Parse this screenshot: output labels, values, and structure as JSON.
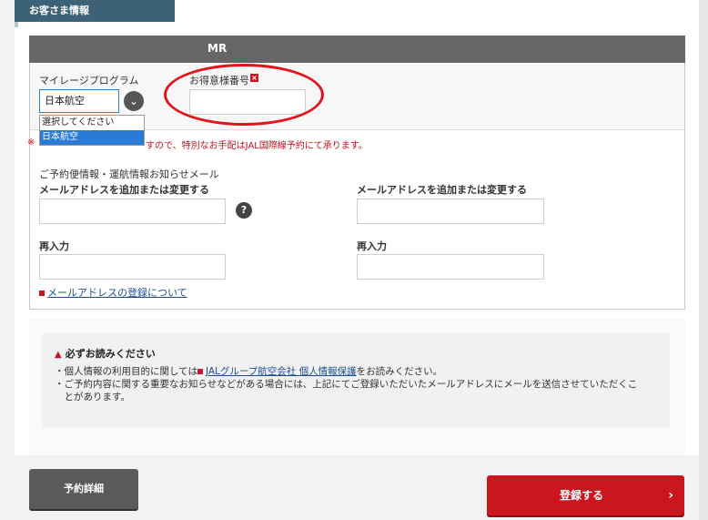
{
  "section": {
    "title": "お客さま情報"
  },
  "passenger": {
    "title_label": "MR"
  },
  "mileage": {
    "program_label": "マイレージプログラム",
    "selected_value": "日本航空",
    "options": [
      "選択してください",
      "日本航空"
    ],
    "member_number_label": "お得意様番号",
    "required_mark": "×",
    "member_number_value": "",
    "notice_visible_tail": "すので、特別なお手配はJAL国際線予約にて承ります。",
    "notice_prefix": "※"
  },
  "email": {
    "heading": "ご予約便情報・運航情報お知らせメール",
    "left_label": "メールアドレスを追加または変更する",
    "right_label": "メールアドレスを追加または変更する",
    "reenter_left": "再入力",
    "reenter_right": "再入力",
    "help_glyph": "?",
    "registration_link": "メールアドレスの登録について"
  },
  "notice": {
    "title": "必ずお読みください",
    "line1_before": "・個人情報の利用目的に関しては",
    "line1_link": "JALグループ航空会社 個人情報保護",
    "line1_after": "をお読みください。",
    "line2": "・ご予約内容に関する重要なお知らせなどがある場合には、上記にてご登録いただいたメールアドレスにメールを送信させていただくこ",
    "line3": "　とがあります。"
  },
  "buttons": {
    "detail": "予約詳細",
    "register": "登録する",
    "register_arrow": "›"
  },
  "icons": {
    "dropdown": "chevron-down-icon",
    "help": "question-icon",
    "warning": "warning-icon",
    "link": "link-square-icon",
    "arrow": "chevron-right-icon"
  },
  "colors": {
    "section_tab": "#3d6278",
    "header_bar": "#666666",
    "accent_red": "#c9161f",
    "annotation_red": "#e0141d",
    "link_blue": "#1b4f93",
    "select_border": "#2a86c8"
  }
}
